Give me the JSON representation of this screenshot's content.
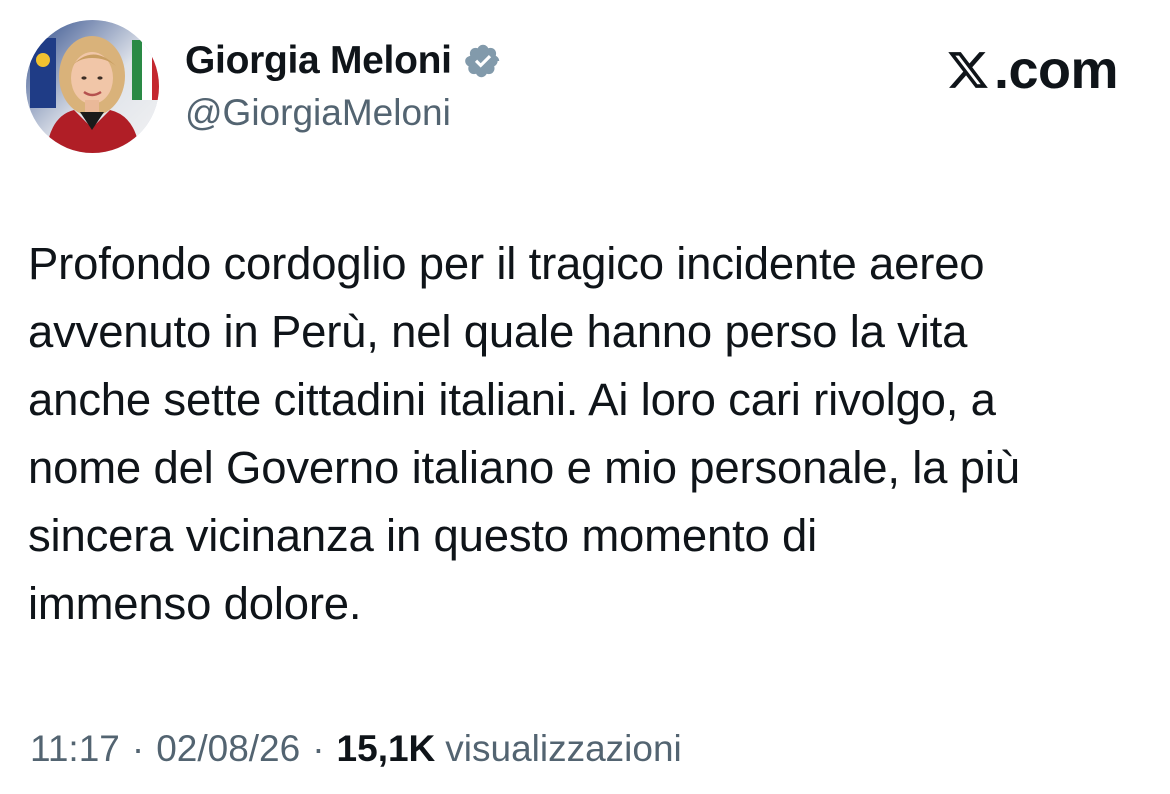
{
  "author": {
    "display_name": "Giorgia Meloni",
    "handle": "@GiorgiaMeloni",
    "verified": true,
    "avatar_icon": "profile-photo",
    "verified_icon": "verified-badge-icon",
    "badge_color": "#829aab"
  },
  "brand": {
    "icon": "x-logo-icon",
    "domain": ".com"
  },
  "tweet": {
    "lines": [
      "Profondo cordoglio per il tragico incidente aereo",
      "avvenuto in Perù, nel quale hanno perso la vita",
      "anche sette cittadini italiani. Ai loro cari rivolgo, a",
      "nome del Governo italiano e mio personale, la più",
      "sincera vicinanza in questo momento di",
      "immenso dolore."
    ]
  },
  "meta": {
    "time": "11:17",
    "separator": "·",
    "date": "02/08/26",
    "views_count": "15,1K",
    "views_label": "visualizzazioni"
  },
  "colors": {
    "text_primary": "#0f1419",
    "text_secondary": "#536471",
    "background": "#ffffff"
  }
}
